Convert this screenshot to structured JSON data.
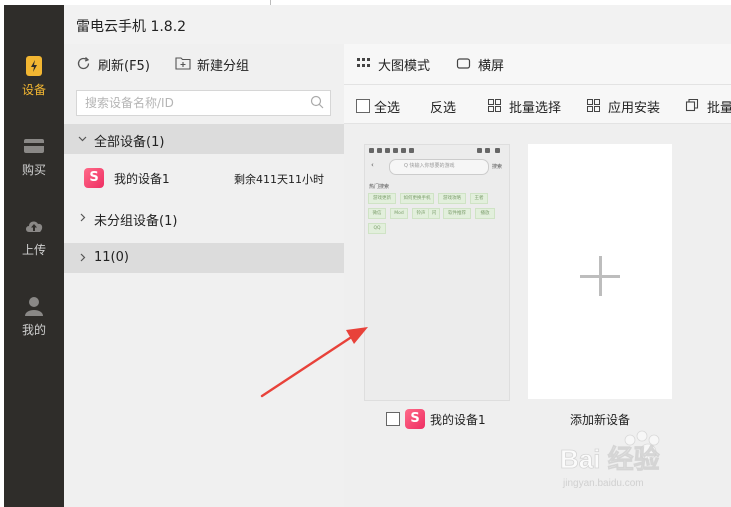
{
  "app": {
    "title": "雷电云手机 1.8.2"
  },
  "nav": {
    "items": [
      {
        "label": "设备",
        "icon": "device-icon",
        "active": true
      },
      {
        "label": "购买",
        "icon": "card-icon",
        "active": false
      },
      {
        "label": "上传",
        "icon": "cloud-upload-icon",
        "active": false
      },
      {
        "label": "我的",
        "icon": "user-icon",
        "active": false
      }
    ]
  },
  "list_toolbar": {
    "refresh_label": "刷新(F5)",
    "new_group_label": "新建分组"
  },
  "search": {
    "placeholder": "搜索设备名称/ID"
  },
  "groups": [
    {
      "name": "全部设备(1)",
      "expanded": true
    },
    {
      "name": "未分组设备(1)",
      "expanded": false
    },
    {
      "name": "11(0)",
      "expanded": false
    }
  ],
  "device": {
    "name": "我的设备1",
    "logo": "S",
    "remaining": "剩余411天11小时"
  },
  "main_toolbar": {
    "large_mode_label": "大图模式",
    "landscape_label": "横屏"
  },
  "batch_toolbar": {
    "select_all": "全选",
    "invert": "反选",
    "batch_select": "批量选择",
    "app_install": "应用安装",
    "batch_more": "批量"
  },
  "cards": {
    "device_label": "我的设备1",
    "add_label": "添加新设备"
  },
  "phone_screen": {
    "search_placeholder": "Q 快输入你想要的游戏",
    "search_btn": "搜索",
    "hot_label": "热门搜索",
    "tags": [
      "游戏更新",
      "如何更换手机",
      "游戏攻略",
      "王者",
      "微信",
      "Mod",
      "铃声",
      "闪",
      "软件推荐",
      "播放",
      "QQ"
    ]
  },
  "watermark": {
    "brand": "Bai 经验",
    "url": "jingyan.baidu.com"
  },
  "colors": {
    "nav_bg": "#2f2d2a",
    "nav_active": "#f2b632",
    "logo_gradient": "#ee2e63",
    "arrow": "#e8423a"
  }
}
